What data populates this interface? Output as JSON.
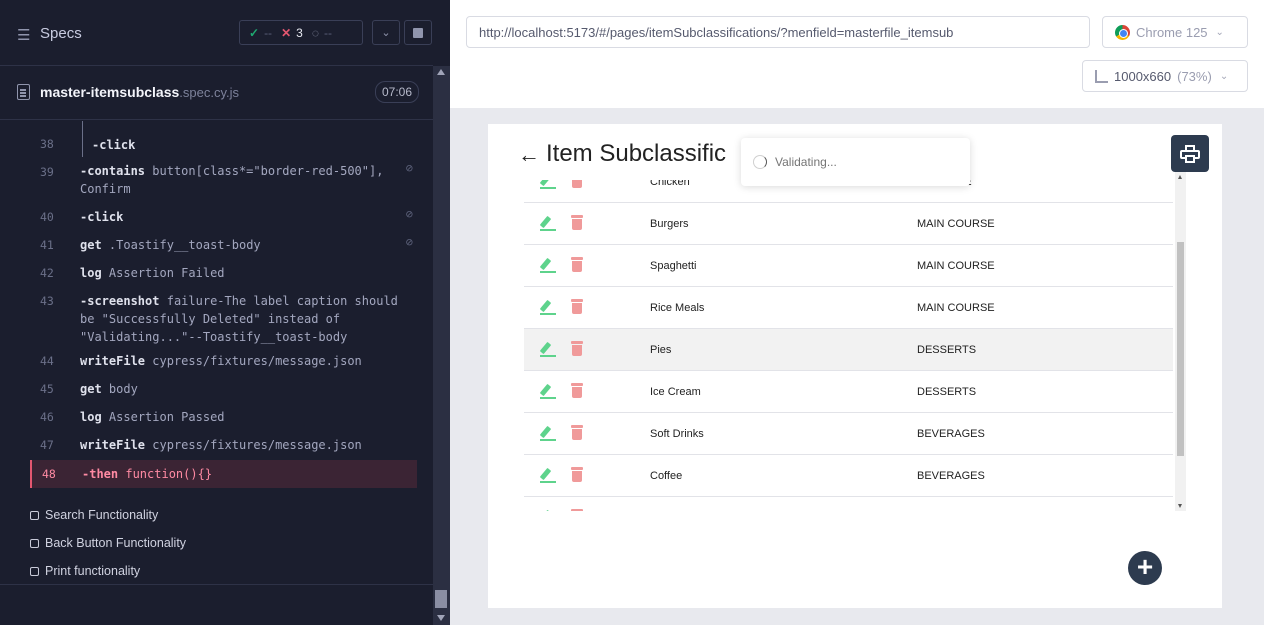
{
  "runner": {
    "specs_label": "Specs",
    "stats": {
      "passed": "--",
      "failed": "3",
      "pending": "--"
    },
    "spec_file": {
      "name": "master-itemsubclass",
      "ext": ".spec.cy.js",
      "duration": "07:06"
    },
    "commands": [
      {
        "line": "38",
        "name": "-click",
        "msg": ""
      },
      {
        "line": "39",
        "name": "-contains",
        "msg": "button[class*=\"border-red-500\"],",
        "msg2": "Confirm"
      },
      {
        "line": "40",
        "name": "-click",
        "msg": ""
      },
      {
        "line": "41",
        "name": "get",
        "msg": ".Toastify__toast-body"
      },
      {
        "line": "42",
        "name": "log",
        "msg": "Assertion Failed"
      },
      {
        "line": "43",
        "name": "-screenshot",
        "msg": "failure-The label caption should",
        "msg2": "be \"Successfully Deleted\" instead of",
        "msg3": "\"Validating...\"--Toastify__toast-body"
      },
      {
        "line": "44",
        "name": "writeFile",
        "msg": "cypress/fixtures/message.json"
      },
      {
        "line": "45",
        "name": "get",
        "msg": "body"
      },
      {
        "line": "46",
        "name": "log",
        "msg": "Assertion Passed"
      },
      {
        "line": "47",
        "name": "writeFile",
        "msg": "cypress/fixtures/message.json"
      },
      {
        "line": "48",
        "name": "-then",
        "msg": "function(){}"
      }
    ],
    "tests": [
      "Search Functionality",
      "Back Button Functionality",
      "Print functionality"
    ]
  },
  "browser": {
    "url": "http://localhost:5173/#/pages/itemSubclassifications/?menfield=masterfile_itemsub",
    "name": "Chrome 125",
    "viewport": "1000x660",
    "zoom": "(73%)"
  },
  "app": {
    "title": "Item Subclassific",
    "toast": "Validating...",
    "rows": [
      {
        "name": "Chicken",
        "class": "RSE"
      },
      {
        "name": "Burgers",
        "class": "MAIN COURSE"
      },
      {
        "name": "Spaghetti",
        "class": "MAIN COURSE"
      },
      {
        "name": "Rice Meals",
        "class": "MAIN COURSE"
      },
      {
        "name": "Pies",
        "class": "DESSERTS"
      },
      {
        "name": "Ice Cream",
        "class": "DESSERTS"
      },
      {
        "name": "Soft Drinks",
        "class": "BEVERAGES"
      },
      {
        "name": "Coffee",
        "class": "BEVERAGES"
      }
    ]
  },
  "colors": {
    "accent_dark": "#2d3b4f",
    "edit_green": "#5ed38c",
    "delete_red": "#f09a9a",
    "fail_red": "#e45770",
    "pass_green": "#1fa971"
  }
}
